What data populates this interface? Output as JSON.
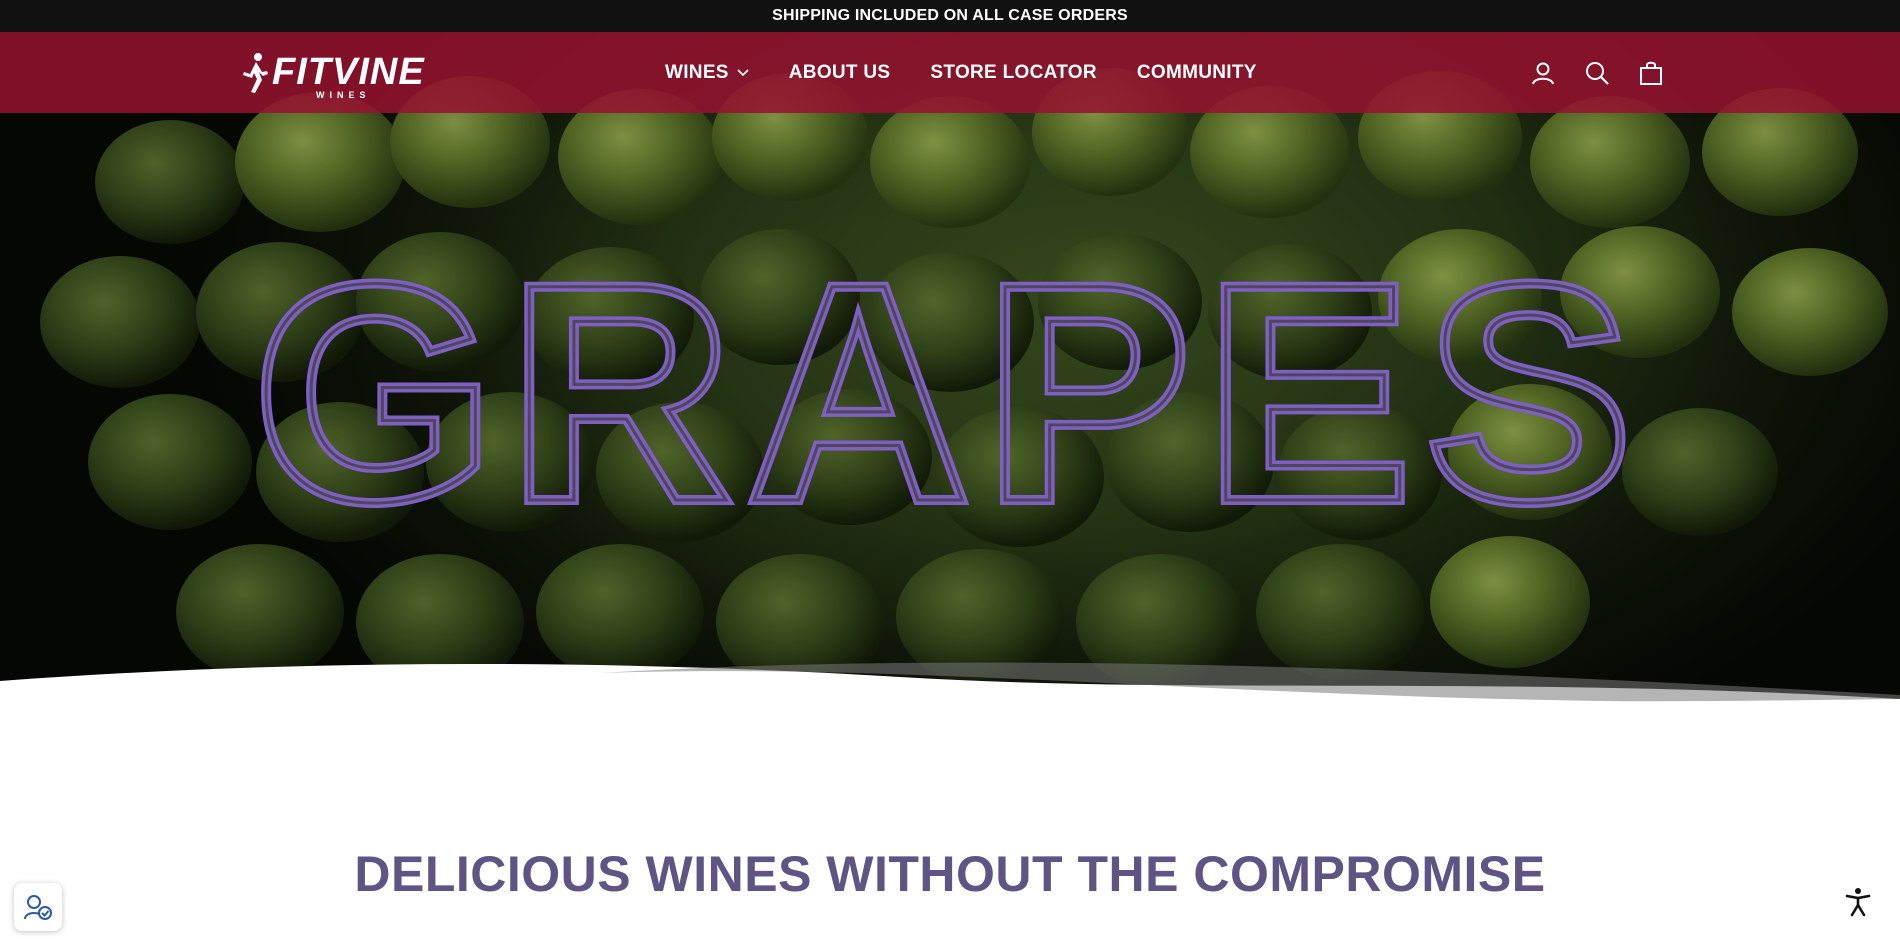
{
  "announcement": {
    "text": "SHIPPING INCLUDED ON ALL CASE ORDERS"
  },
  "brand": {
    "name": "FITVINE",
    "subtitle": "WINES",
    "logo_icon": "runner-icon"
  },
  "nav": {
    "items": [
      {
        "label": "WINES",
        "has_dropdown": true
      },
      {
        "label": "ABOUT US",
        "has_dropdown": false
      },
      {
        "label": "STORE LOCATOR",
        "has_dropdown": false
      },
      {
        "label": "COMMUNITY",
        "has_dropdown": false
      }
    ]
  },
  "header_icons": [
    "account-icon",
    "search-icon",
    "cart-icon"
  ],
  "hero": {
    "title": "GRAPES"
  },
  "section": {
    "headline": "DELICIOUS WINES WITHOUT THE COMPROMISE"
  },
  "widgets": {
    "left": "cookie-consent-icon",
    "right": "accessibility-icon"
  },
  "colors": {
    "announcement_bg": "#111111",
    "header_bg": "#961230",
    "hero_title": "#7f5fc4",
    "headline": "#5f5483"
  }
}
